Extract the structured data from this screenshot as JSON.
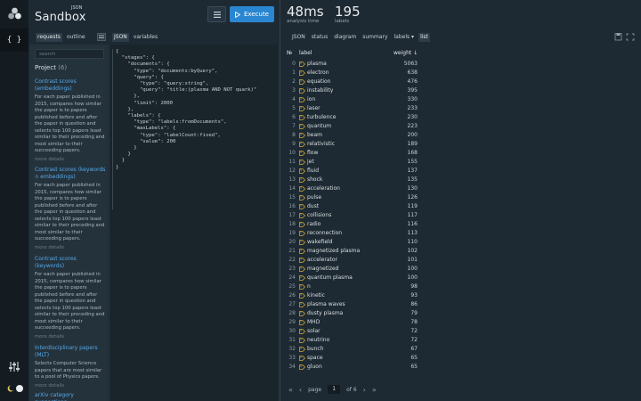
{
  "brand": {
    "json": "JSON",
    "sandbox": "Sandbox"
  },
  "toolbar": {
    "execute_label": "Execute"
  },
  "stats": [
    {
      "value": "48ms",
      "label": "analysis time"
    },
    {
      "value": "195",
      "label": "labels"
    }
  ],
  "left_tabs": [
    "requests",
    "outline"
  ],
  "editor_tabs": [
    "JSON",
    "variables"
  ],
  "result_tabs": [
    "JSON",
    "status",
    "diagram",
    "summary",
    "labels",
    "list"
  ],
  "sidebar": {
    "search_placeholder": "search",
    "project_title": "Project",
    "project_count": "(6)",
    "entries": [
      {
        "title": "Contrast scores (embeddings)",
        "desc": "For each paper published in 2015, compares how similar the paper is to papers published before and after the paper in question and selects top 100 papers least similar to their preceding and most similar to their succeeding papers.",
        "more": "more details"
      },
      {
        "title": "Contrast scores (keywords ∩ embeddings)",
        "desc": "For each paper published in 2015, compares how similar the paper is to papers published before and after the paper in question and selects top 100 papers least similar to their preceding and most similar to their succeeding papers.",
        "more": "more details"
      },
      {
        "title": "Contrast scores (keywords)",
        "desc": "For each paper published in 2015, compares how similar the paper is to papers published before and after the paper in question and selects top 100 papers least similar to their preceding and most similar to their succeeding papers.",
        "more": "more details"
      },
      {
        "title": "Interdisciplinary papers (MLT)",
        "desc": "Selects Computer Science papers that are most similar to a pool of Physics papers.",
        "more": "more details"
      },
      {
        "title": "arXiv category suggestions",
        "desc": "",
        "more": ""
      }
    ]
  },
  "editor": {
    "code": "{\n  \"stages\": {\n    \"documents\": {\n      \"type\": \"documents:byQuery\",\n      \"query\": {\n        \"type\": \"query:string\",\n        \"query\": \"title:(plasma AND NOT quark)\"\n      },\n      \"limit\": 2000\n    },\n    \"labels\": {\n      \"type\": \"labels:fromDocuments\",\n      \"maxLabels\": {\n        \"type\": \"labelCount:fixed\",\n        \"value\": 200\n      }\n    }\n  }\n}"
  },
  "table": {
    "headers": {
      "no": "№",
      "label": "label",
      "weight": "weight ↓"
    },
    "rows": [
      {
        "no": "0",
        "label": "plasma",
        "weight": "5063"
      },
      {
        "no": "1",
        "label": "electron",
        "weight": "638"
      },
      {
        "no": "2",
        "label": "equation",
        "weight": "476"
      },
      {
        "no": "3",
        "label": "instability",
        "weight": "395"
      },
      {
        "no": "4",
        "label": "ion",
        "weight": "330"
      },
      {
        "no": "5",
        "label": "laser",
        "weight": "233"
      },
      {
        "no": "6",
        "label": "turbulence",
        "weight": "230"
      },
      {
        "no": "7",
        "label": "quantum",
        "weight": "223"
      },
      {
        "no": "8",
        "label": "beam",
        "weight": "200"
      },
      {
        "no": "9",
        "label": "relativistic",
        "weight": "189"
      },
      {
        "no": "10",
        "label": "flow",
        "weight": "168"
      },
      {
        "no": "11",
        "label": "jet",
        "weight": "155"
      },
      {
        "no": "12",
        "label": "fluid",
        "weight": "137"
      },
      {
        "no": "13",
        "label": "shock",
        "weight": "135"
      },
      {
        "no": "14",
        "label": "acceleration",
        "weight": "130"
      },
      {
        "no": "15",
        "label": "pulse",
        "weight": "126"
      },
      {
        "no": "16",
        "label": "dust",
        "weight": "119"
      },
      {
        "no": "17",
        "label": "collisions",
        "weight": "117"
      },
      {
        "no": "18",
        "label": "radio",
        "weight": "116"
      },
      {
        "no": "19",
        "label": "reconnection",
        "weight": "113"
      },
      {
        "no": "20",
        "label": "wakefield",
        "weight": "110"
      },
      {
        "no": "21",
        "label": "magnetized plasma",
        "weight": "102"
      },
      {
        "no": "22",
        "label": "accelerator",
        "weight": "101"
      },
      {
        "no": "23",
        "label": "magnetized",
        "weight": "100"
      },
      {
        "no": "24",
        "label": "quantum plasma",
        "weight": "100"
      },
      {
        "no": "25",
        "label": "n",
        "weight": "98"
      },
      {
        "no": "26",
        "label": "kinetic",
        "weight": "93"
      },
      {
        "no": "27",
        "label": "plasma waves",
        "weight": "86"
      },
      {
        "no": "28",
        "label": "dusty plasma",
        "weight": "79"
      },
      {
        "no": "29",
        "label": "MHD",
        "weight": "78"
      },
      {
        "no": "30",
        "label": "solar",
        "weight": "72"
      },
      {
        "no": "31",
        "label": "neutrino",
        "weight": "72"
      },
      {
        "no": "32",
        "label": "bunch",
        "weight": "67"
      },
      {
        "no": "33",
        "label": "space",
        "weight": "65"
      },
      {
        "no": "34",
        "label": "gluon",
        "weight": "65"
      }
    ]
  },
  "pager": {
    "page_word": "page",
    "current": "1",
    "of_word": "of",
    "total": "6"
  },
  "colors": {
    "accent": "#2a86d0",
    "link": "#57a9e8",
    "tag": "#d9b13b"
  }
}
